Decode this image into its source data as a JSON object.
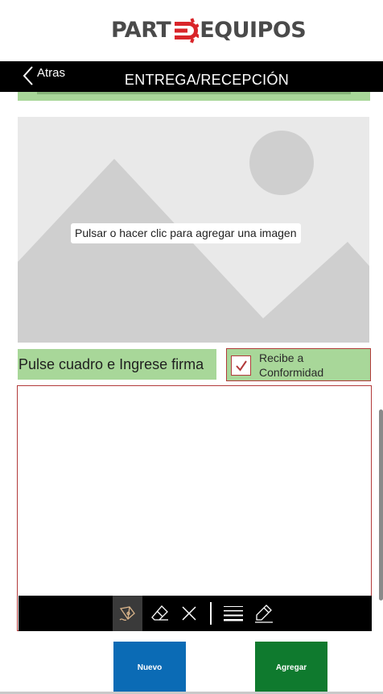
{
  "app": {
    "logo_text_left": "PART",
    "logo_text_right": "EQUIPOS"
  },
  "nav": {
    "back_label": "Atras",
    "title": "ENTREGA/RECEPCIÓN"
  },
  "image_picker": {
    "hint": "Pulsar o hacer clic para agregar una imagen",
    "icon": "image-placeholder-icon"
  },
  "signature": {
    "instruction": "Pulse cuadro e Ingrese firma",
    "conformity_label": "Recibe a Conformidad",
    "conformity_checked": true,
    "tools": [
      "pen-icon",
      "eraser-icon",
      "clear-icon",
      "stroke-width-icon",
      "edit-color-icon"
    ],
    "active_tool": "pen-icon"
  },
  "actions": {
    "new_label": "Nuevo",
    "add_label": "Agregar"
  },
  "colors": {
    "brand_red": "#d9252a",
    "accent_green": "#a8d799",
    "border_red": "#b23a3a",
    "btn_blue": "#0b6bb5",
    "btn_green": "#0f7a2e"
  }
}
